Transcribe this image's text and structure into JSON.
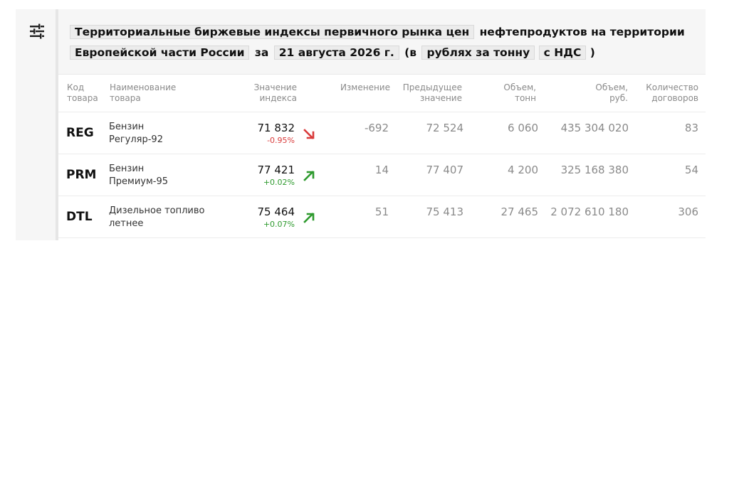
{
  "title": {
    "part1": "Территориальные биржевые индексы первичного рынка цен",
    "part2": "нефтепродуктов на территории",
    "region": "Европейской части России",
    "za": "за",
    "date": "21 августа 2026 г.",
    "open_paren": "(в",
    "units": "рублях за тонну",
    "vat": "с НДС",
    "close_paren": ")"
  },
  "columns": {
    "code": "Код\nтовара",
    "name": "Наименование\nтовара",
    "index_value": "Значение\nиндекса",
    "change": "Изменение",
    "previous": "Предыдущее\nзначение",
    "volume_t": "Объем,\nтонн",
    "volume_rub": "Объем,\nруб.",
    "contracts": "Количество\nдоговоров"
  },
  "rows": [
    {
      "code": "REG",
      "name": "Бензин\nРегуляр-92",
      "value": "71 832",
      "pct": "-0.95%",
      "direction": "down",
      "change": "-692",
      "previous": "72 524",
      "volume_t": "6 060",
      "volume_rub": "435 304 020",
      "contracts": "83"
    },
    {
      "code": "PRM",
      "name": "Бензин\nПремиум-95",
      "value": "77 421",
      "pct": "+0.02%",
      "direction": "up",
      "change": "14",
      "previous": "77 407",
      "volume_t": "4 200",
      "volume_rub": "325 168 380",
      "contracts": "54"
    },
    {
      "code": "DTL",
      "name": "Дизельное топливо\nлетнее",
      "value": "75 464",
      "pct": "+0.07%",
      "direction": "up",
      "change": "51",
      "previous": "75 413",
      "volume_t": "27 465",
      "volume_rub": "2 072 610 180",
      "contracts": "306"
    }
  ],
  "colors": {
    "down": "#d93b3b",
    "up": "#2e9a2e"
  },
  "icons": {
    "filter": "sliders-icon",
    "down": "arrow-down-right-icon",
    "up": "arrow-up-right-icon"
  }
}
